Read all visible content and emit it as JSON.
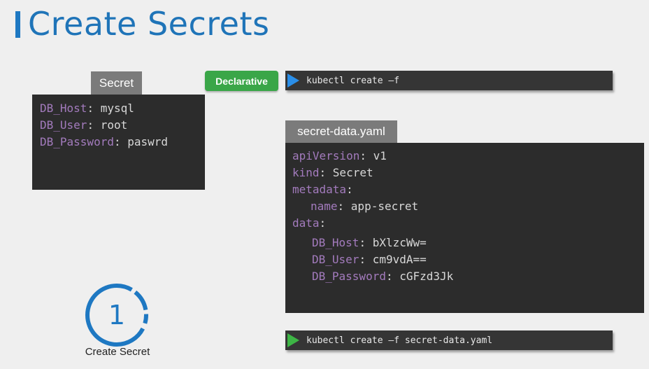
{
  "title": "Create Secrets",
  "accent": "#1f74b8",
  "secret_panel": {
    "tab": "Secret",
    "lines": [
      {
        "key": "DB_Host",
        "value": "mysql"
      },
      {
        "key": "DB_User",
        "value": "root"
      },
      {
        "key": "DB_Password",
        "value": "paswrd"
      }
    ]
  },
  "badge": {
    "label": "Declarative",
    "color": "#3aa648"
  },
  "command_top": {
    "text": "kubectl create –f",
    "icon": "play-triangle-blue-icon"
  },
  "yaml_panel": {
    "tab": "secret-data.yaml",
    "lines": [
      {
        "key": "apiVersion",
        "value": "v1",
        "indent": 0
      },
      {
        "key": "kind",
        "value": "Secret",
        "indent": 0
      },
      {
        "key": "metadata",
        "value": "",
        "indent": 0
      },
      {
        "key": "name",
        "value": "app-secret",
        "indent": 1
      },
      {
        "key": "data",
        "value": "",
        "indent": 0
      },
      {
        "key": "DB_Host",
        "value": "bXlzcWw=",
        "indent": 1
      },
      {
        "key": "DB_User",
        "value": "cm9vdA==",
        "indent": 1
      },
      {
        "key": "DB_Password",
        "value": "cGFzd3Jk",
        "indent": 1
      }
    ]
  },
  "command_bottom": {
    "text": "kubectl create –f secret-data.yaml",
    "icon": "play-triangle-green-icon"
  },
  "step": {
    "number": "1",
    "label": "Create Secret"
  }
}
